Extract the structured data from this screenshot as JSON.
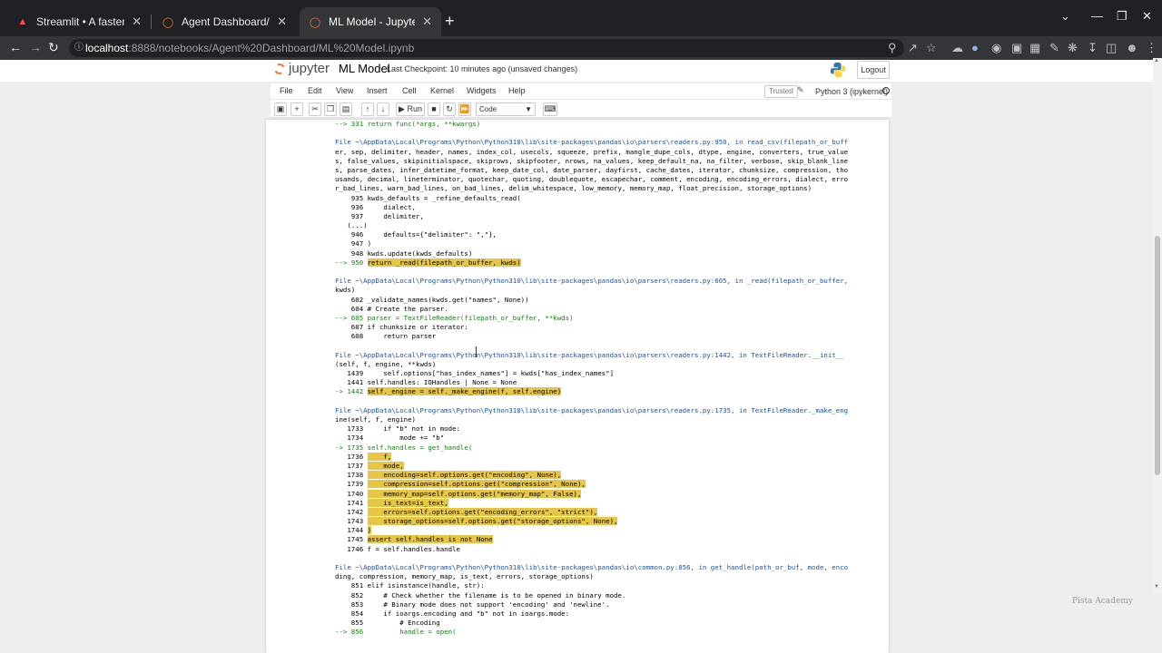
{
  "browser": {
    "tabs": [
      {
        "label": "Streamlit • A faster way to build",
        "icon": "streamlit-icon",
        "active": false
      },
      {
        "label": "Agent Dashboard/",
        "icon": "jupyter-icon",
        "active": false
      },
      {
        "label": "ML Model - Jupyter Notebook",
        "icon": "jupyter-icon",
        "active": true
      }
    ],
    "url_host": "localhost",
    "url_path": ":8888/notebooks/Agent%20Dashboard/ML%20Model.ipynb"
  },
  "jupyter": {
    "logo_text": "jupyter",
    "notebook_name": "ML Model",
    "checkpoint": "Last Checkpoint: 10 minutes ago  (unsaved changes)",
    "logout": "Logout",
    "menu": [
      "File",
      "Edit",
      "View",
      "Insert",
      "Cell",
      "Kernel",
      "Widgets",
      "Help"
    ],
    "trusted": "Trusted",
    "kernel": "Python 3 (ipykernel)",
    "run_label": "Run",
    "cell_type": "Code"
  },
  "traceback": [
    "--> 331 return func(*args, **kwargs)",
    "",
    "File ~\\AppData\\Local\\Programs\\Python\\Python310\\lib\\site-packages\\pandas\\io\\parsers\\readers.py:950, in read_csv(filepath_or_buff",
    "er, sep, delimiter, header, names, index_col, usecols, squeeze, prefix, mangle_dupe_cols, dtype, engine, converters, true_value",
    "s, false_values, skipinitialspace, skiprows, skipfooter, nrows, na_values, keep_default_na, na_filter, verbose, skip_blank_line",
    "s, parse_dates, infer_datetime_format, keep_date_col, date_parser, dayfirst, cache_dates, iterator, chunksize, compression, tho",
    "usands, decimal, lineterminator, quotechar, quoting, doublequote, escapechar, comment, encoding, encoding_errors, dialect, erro",
    "r_bad_lines, warn_bad_lines, on_bad_lines, delim_whitespace, low_memory, memory_map, float_precision, storage_options)",
    "    935 kwds_defaults = _refine_defaults_read(",
    "    936     dialect,",
    "    937     delimiter,",
    "   (...)",
    "    946     defaults={\"delimiter\": \",\"},",
    "    947 )",
    "    948 kwds.update(kwds_defaults)",
    "--> 950 return _read(filepath_or_buffer, kwds)",
    "",
    "File ~\\AppData\\Local\\Programs\\Python\\Python310\\lib\\site-packages\\pandas\\io\\parsers\\readers.py:605, in _read(filepath_or_buffer,",
    "kwds)",
    "    602 _validate_names(kwds.get(\"names\", None))",
    "    604 # Create the parser.",
    "--> 605 parser = TextFileReader(filepath_or_buffer, **kwds)",
    "    607 if chunksize or iterator:",
    "    608     return parser",
    "",
    "File ~\\AppData\\Local\\Programs\\Python\\Python310\\lib\\site-packages\\pandas\\io\\parsers\\readers.py:1442, in TextFileReader.__init__",
    "(self, f, engine, **kwds)",
    "   1439     self.options[\"has_index_names\"] = kwds[\"has_index_names\"]",
    "   1441 self.handles: IOHandles | None = None",
    "-> 1442 self._engine = self._make_engine(f, self.engine)",
    "",
    "File ~\\AppData\\Local\\Programs\\Python\\Python310\\lib\\site-packages\\pandas\\io\\parsers\\readers.py:1735, in TextFileReader._make_eng",
    "ine(self, f, engine)",
    "   1733     if \"b\" not in mode:",
    "   1734         mode += \"b\"",
    "-> 1735 self.handles = get_handle(",
    "   1736     f,",
    "   1737     mode,",
    "   1738     encoding=self.options.get(\"encoding\", None),",
    "   1739     compression=self.options.get(\"compression\", None),",
    "   1740     memory_map=self.options.get(\"memory_map\", False),",
    "   1741     is_text=is_text,",
    "   1742     errors=self.options.get(\"encoding_errors\", \"strict\"),",
    "   1743     storage_options=self.options.get(\"storage_options\", None),",
    "   1744 )",
    "   1745 assert self.handles is not None",
    "   1746 f = self.handles.handle",
    "",
    "File ~\\AppData\\Local\\Programs\\Python\\Python310\\lib\\site-packages\\pandas\\io\\common.py:856, in get_handle(path_or_buf, mode, enco",
    "ding, compression, memory_map, is_text, errors, storage_options)",
    "    851 elif isinstance(handle, str):",
    "    852     # Check whether the filename is to be opened in binary mode.",
    "    853     # Binary mode does not support 'encoding' and 'newline'.",
    "    854     if ioargs.encoding and \"b\" not in ioargs.mode:",
    "    855         # Encoding",
    "--> 856         handle = open("
  ],
  "watermark": "Pista Academy",
  "colors": {
    "highlight": "#e7c646",
    "arrow": "#128312",
    "link": "#1a8f9a"
  }
}
